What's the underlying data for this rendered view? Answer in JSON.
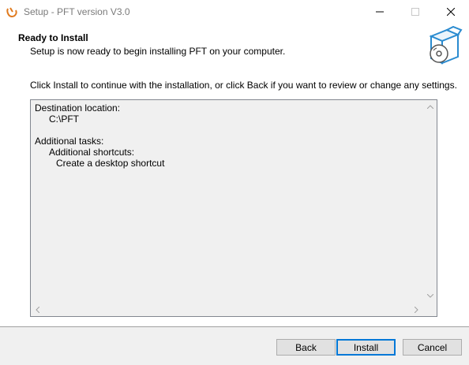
{
  "window": {
    "title": "Setup - PFT version V3.0"
  },
  "header": {
    "heading": "Ready to Install",
    "subheading": "Setup is now ready to begin installing PFT on your computer."
  },
  "main": {
    "instructions": "Click Install to continue with the installation, or click Back if you want to review or change any settings.",
    "memo": {
      "destination_label": "Destination location:",
      "destination_value": "C:\\PFT",
      "tasks_label": "Additional tasks:",
      "shortcuts_label": "Additional shortcuts:",
      "shortcut_item": "Create a desktop shortcut"
    }
  },
  "footer": {
    "back_label": "Back",
    "install_label": "Install",
    "cancel_label": "Cancel"
  },
  "icons": {
    "app": "installer-app-icon",
    "header": "package-box-disc-icon"
  },
  "colors": {
    "focus_border": "#0078d7",
    "footer_bg": "#f0f0f0",
    "memo_bg": "#f0f0f0"
  }
}
